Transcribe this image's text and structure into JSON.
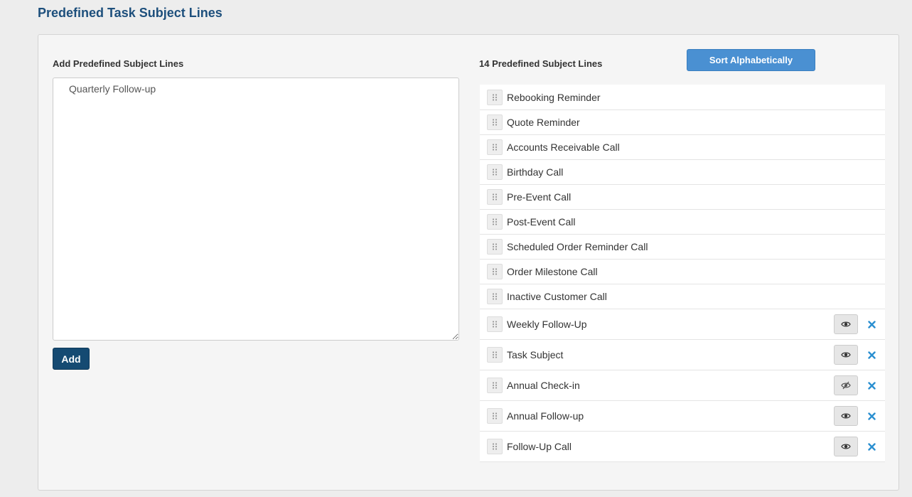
{
  "page": {
    "title": "Predefined Task Subject Lines"
  },
  "add_section": {
    "heading": "Add Predefined Subject Lines",
    "textarea_value": "Quarterly Follow-up",
    "add_label": "Add"
  },
  "list_section": {
    "heading": "14 Predefined Subject Lines",
    "sort_label": "Sort Alphabetically",
    "items": [
      {
        "label": "Rebooking Reminder",
        "editable": false
      },
      {
        "label": "Quote Reminder",
        "editable": false
      },
      {
        "label": "Accounts Receivable Call",
        "editable": false
      },
      {
        "label": "Birthday Call",
        "editable": false
      },
      {
        "label": "Pre-Event Call",
        "editable": false
      },
      {
        "label": "Post-Event Call",
        "editable": false
      },
      {
        "label": "Scheduled Order Reminder Call",
        "editable": false
      },
      {
        "label": "Order Milestone Call",
        "editable": false
      },
      {
        "label": "Inactive Customer Call",
        "editable": false
      },
      {
        "label": "Weekly Follow-Up",
        "editable": true,
        "visibility_icon": "eye-icon"
      },
      {
        "label": "Task Subject",
        "editable": true,
        "visibility_icon": "eye-icon"
      },
      {
        "label": "Annual Check-in",
        "editable": true,
        "visibility_icon": "eye-slash-icon"
      },
      {
        "label": "Annual Follow-up",
        "editable": true,
        "visibility_icon": "eye-icon"
      },
      {
        "label": "Follow-Up Call",
        "editable": true,
        "visibility_icon": "eye-icon"
      }
    ]
  },
  "colors": {
    "title": "#1d4f7c",
    "add_button": "#154a72",
    "sort_button": "#4a90d2",
    "delete_icon": "#2a8fd0"
  }
}
